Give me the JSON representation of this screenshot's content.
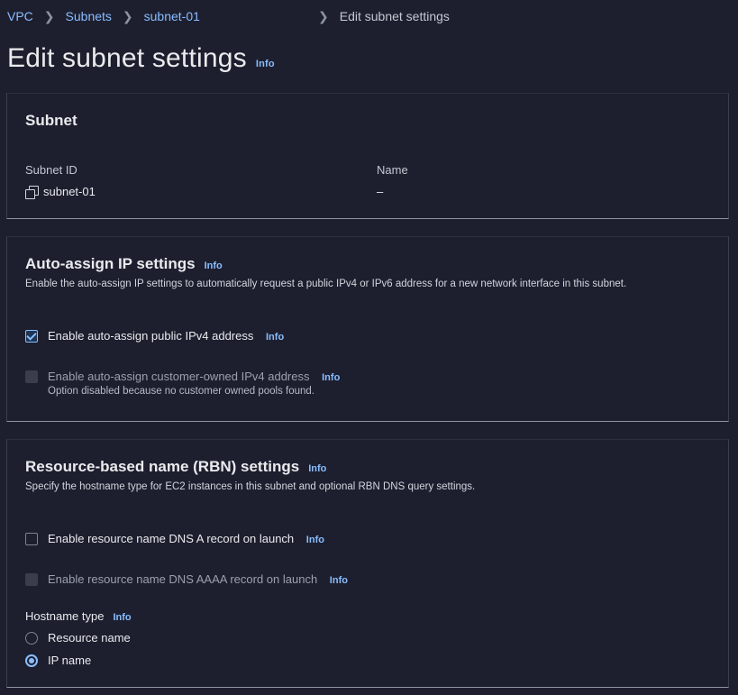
{
  "breadcrumb": {
    "items": [
      "VPC",
      "Subnets",
      "subnet-01"
    ],
    "current": "Edit subnet settings"
  },
  "page": {
    "title": "Edit subnet settings",
    "info": "Info"
  },
  "subnet": {
    "header": "Subnet",
    "subnet_id_label": "Subnet ID",
    "subnet_id_value": "subnet-01",
    "name_label": "Name",
    "name_value": "–"
  },
  "auto_assign": {
    "header": "Auto-assign IP settings",
    "info": "Info",
    "description": "Enable the auto-assign IP settings to automatically request a public IPv4 or IPv6 address for a new network interface in this subnet.",
    "public_ipv4": {
      "label": "Enable auto-assign public IPv4 address",
      "info": "Info",
      "checked": true
    },
    "customer_owned": {
      "label": "Enable auto-assign customer-owned IPv4 address",
      "info": "Info",
      "sub": "Option disabled because no customer owned pools found.",
      "disabled": true
    }
  },
  "rbn": {
    "header": "Resource-based name (RBN) settings",
    "info": "Info",
    "description": "Specify the hostname type for EC2 instances in this subnet and optional RBN DNS query settings.",
    "dns_a": {
      "label": "Enable resource name DNS A record on launch",
      "info": "Info",
      "checked": false
    },
    "dns_aaaa": {
      "label": "Enable resource name DNS AAAA record on launch",
      "info": "Info",
      "disabled": true
    },
    "hostname_type": {
      "label": "Hostname type",
      "info": "Info",
      "options": [
        "Resource name",
        "IP name"
      ],
      "selected": "IP name"
    }
  },
  "colors": {
    "background": "#1d1f2f",
    "link": "#89bdff",
    "text": "#e9ebed"
  }
}
